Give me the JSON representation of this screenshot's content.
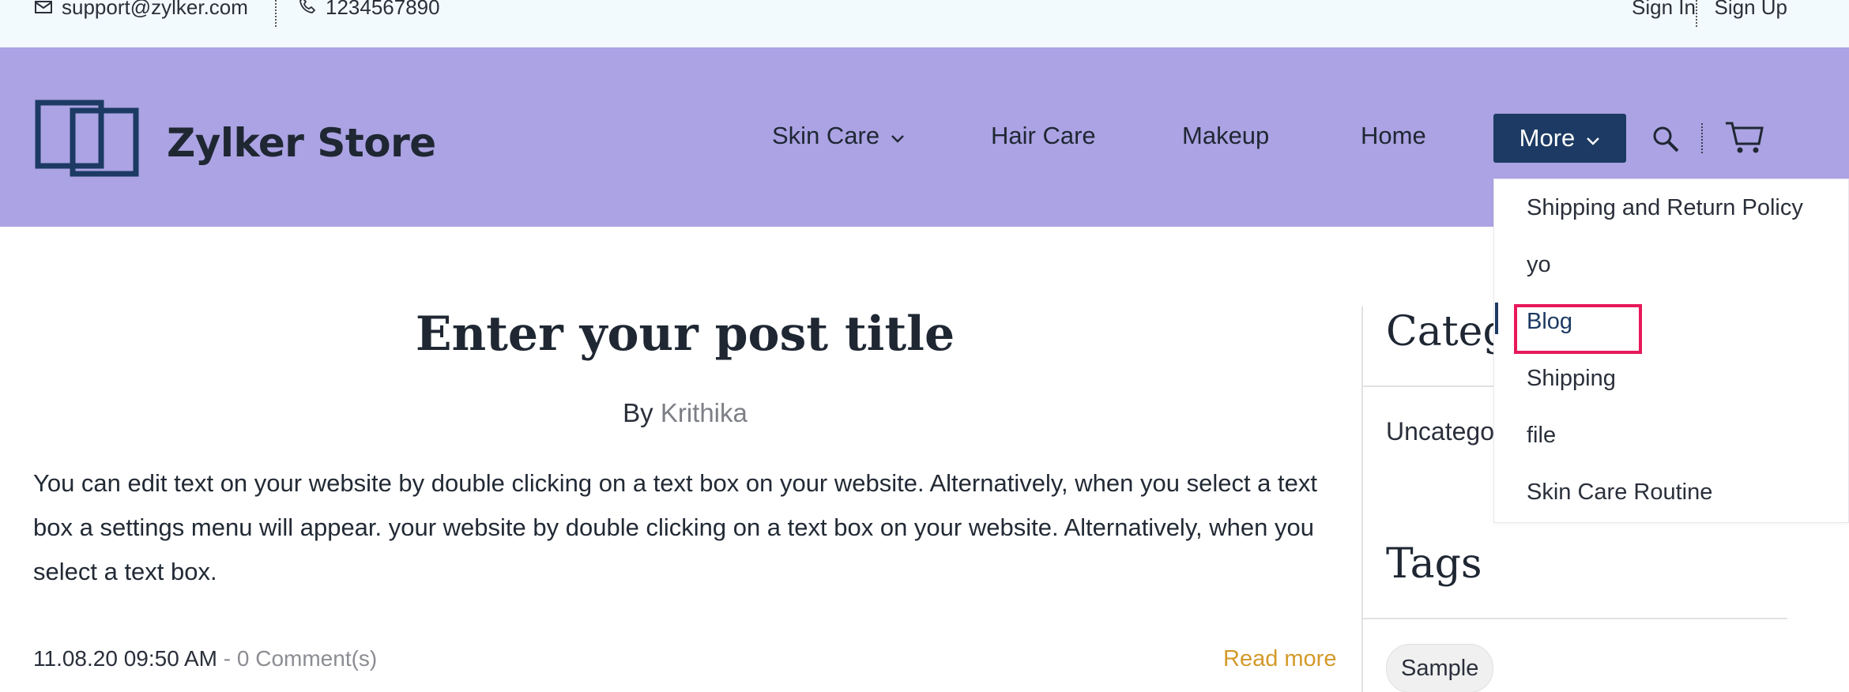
{
  "topbar": {
    "email": "support@zylker.com",
    "phone": "1234567890",
    "sign_in": "Sign In",
    "sign_up": "Sign Up"
  },
  "header": {
    "brand": "Zylker Store",
    "nav": {
      "skin_care": "Skin Care",
      "hair_care": "Hair Care",
      "makeup": "Makeup",
      "home": "Home",
      "more": "More"
    },
    "icons": [
      "mail-icon",
      "phone-icon",
      "chevron-down-icon",
      "search-icon",
      "cart-icon"
    ]
  },
  "more_menu": {
    "items": [
      "Shipping and Return Policy",
      "yo",
      "Blog",
      "Shipping",
      "file",
      "Skin Care Routine"
    ],
    "highlighted": "Blog"
  },
  "post": {
    "title": "Enter your post title",
    "by_label": "By",
    "author": "Krithika",
    "body": "You can edit text on your website by double clicking on a text box on your website. Alternatively, when you select a text box a settings menu will appear. your website by double clicking on a text box on your website. Alternatively, when you select a text box.",
    "date": "11.08.20 09:50 AM",
    "comments": "- 0 Comment(s)",
    "read_more": "Read more"
  },
  "sidebar": {
    "categories_heading": "Categ",
    "category_item": "Uncatego",
    "tags_heading": "Tags",
    "tag": "Sample"
  },
  "colors": {
    "topbar_bg": "#f3fafd",
    "header_bg": "#aba3e3",
    "more_button_bg": "#1c3a63",
    "read_more": "#d39a2a",
    "highlight_border": "#e8185a"
  }
}
